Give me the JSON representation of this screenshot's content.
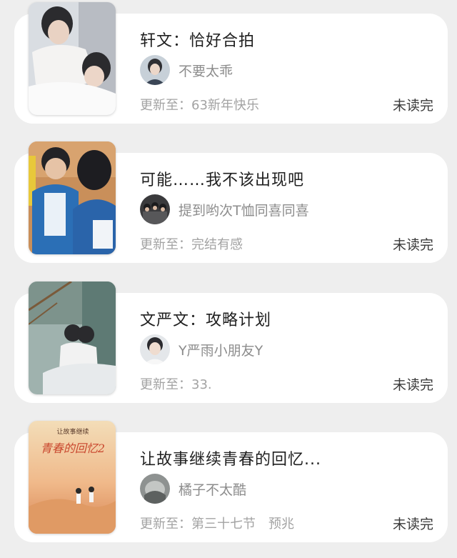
{
  "books": [
    {
      "title": "轩文：恰好合拍",
      "author": "不要太乖",
      "update_prefix": "更新至：",
      "update_chapter": "63新年快乐",
      "status": "未读完"
    },
    {
      "title": "可能……我不该出现吧",
      "author": "提到哟次T恤同喜同喜",
      "update_prefix": "更新至：",
      "update_chapter": "完结有感",
      "status": "未读完"
    },
    {
      "title": "文严文：攻略计划",
      "author": "Y严雨小朋友Y",
      "update_prefix": "更新至：",
      "update_chapter": "33.",
      "status": "未读完"
    },
    {
      "title": "让故事继续青春的回忆...",
      "author": "橘子不太酷",
      "update_prefix": "更新至：",
      "update_chapter": "第三十七节　预兆",
      "status": "未读完",
      "cover_text_top": "让故事继续",
      "cover_text_main": "青春的回忆2"
    }
  ]
}
